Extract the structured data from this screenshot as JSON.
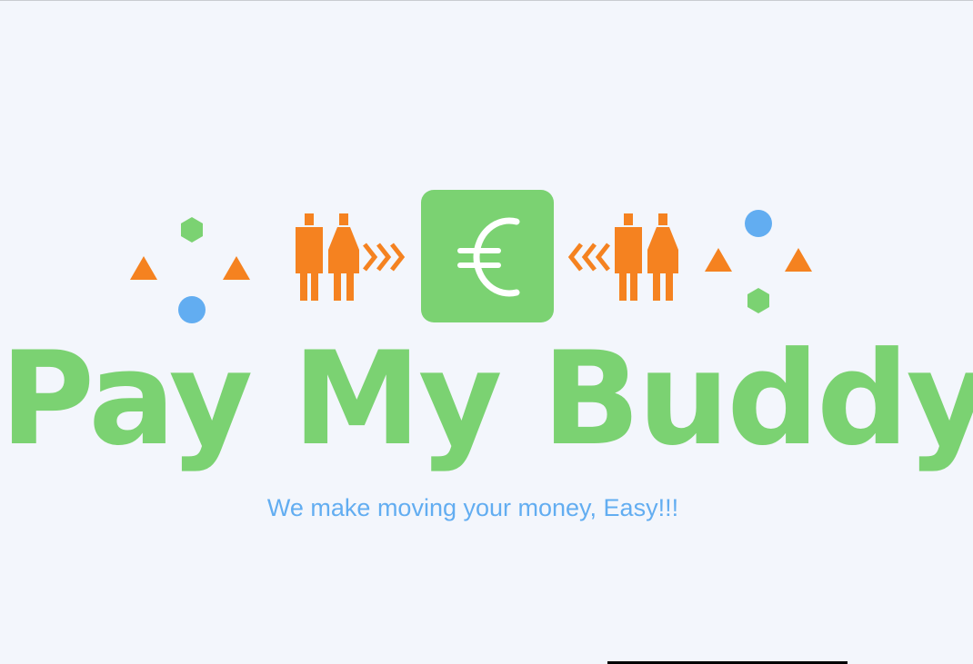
{
  "brand": {
    "title": "Pay My Buddy",
    "tagline": "We make moving your money, Easy!!!",
    "currency_symbol": "€"
  },
  "colors": {
    "background": "#f3f6fc",
    "green": "#7bd272",
    "orange": "#f58220",
    "blue": "#62adf1",
    "card_text": "#ffffff"
  },
  "icons": [
    "left-shape-cluster-icon",
    "left-people-pair-icon",
    "right-pointing-chevrons-icon",
    "euro-card-icon",
    "left-pointing-chevrons-icon",
    "right-people-pair-icon",
    "right-shape-cluster-icon"
  ]
}
